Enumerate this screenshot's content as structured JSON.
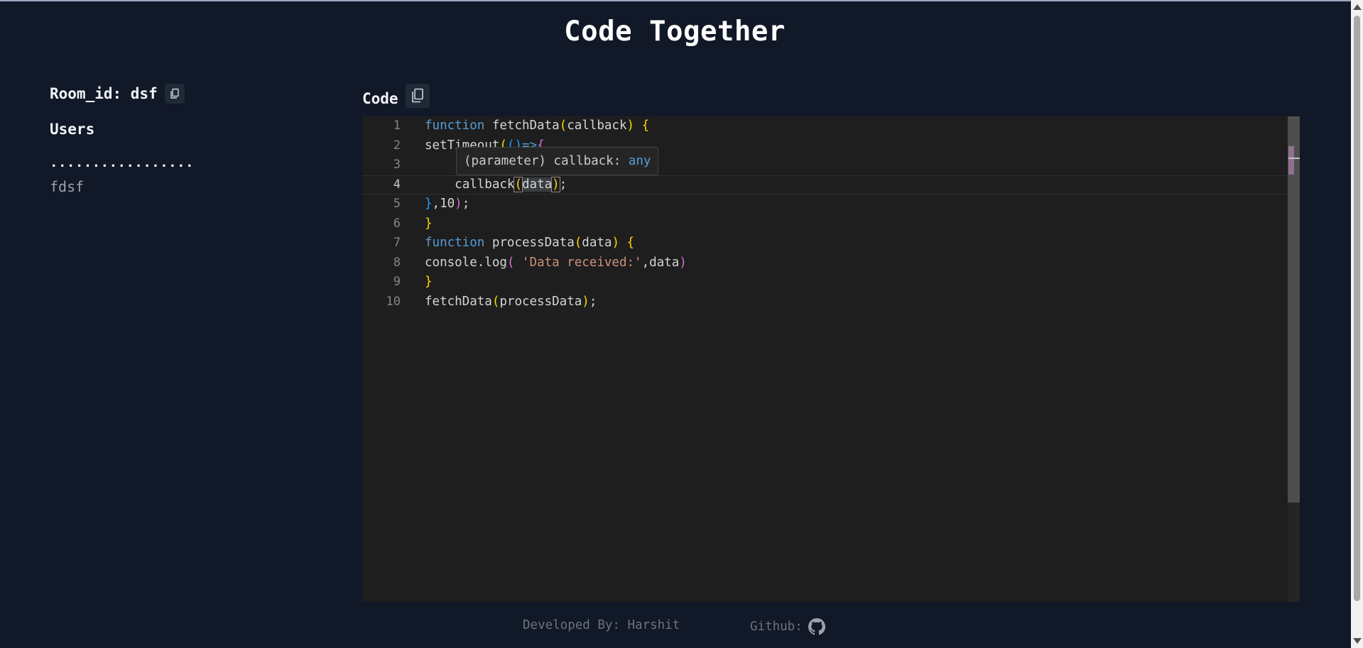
{
  "title": "Code Together",
  "room": {
    "label": "Room_id: dsf"
  },
  "users": {
    "title": "Users",
    "divider": ".................",
    "items": [
      "fdsf"
    ]
  },
  "code": {
    "label": "Code"
  },
  "editor": {
    "line_numbers": [
      "1",
      "2",
      "3",
      "4",
      "5",
      "6",
      "7",
      "8",
      "9",
      "10"
    ],
    "active_line": "4",
    "tooltip": {
      "prefix": "(parameter) callback: ",
      "type": "any"
    },
    "tokens": {
      "l1_kw": "function",
      "l1_fn": "fetchData",
      "l1_po": "(",
      "l1_arg": "callback",
      "l1_pc": ")",
      "l1_brace": " {",
      "l2_fn": "setTimeout",
      "l2_po": "(",
      "l2_args": "()",
      "l2_arrow": "=>",
      "l2_brace": "{",
      "l4_fn": "callback",
      "l4_po": "(",
      "l4_arg": "data",
      "l4_pc": ")",
      "l4_semi": ";",
      "l5_brace": "}",
      "l5_rest": ",10",
      "l5_pc": ")",
      "l5_semi": ";",
      "l6_brace": "}",
      "l7_kw": "function",
      "l7_fn": "processData",
      "l7_po": "(",
      "l7_arg": "data",
      "l7_pc": ")",
      "l7_brace": " {",
      "l8_obj": "console.log",
      "l8_po": "(",
      "l8_str": " 'Data received:'",
      "l8_rest": ",data",
      "l8_pc": ")",
      "l9_brace": "}",
      "l10_fn": "fetchData",
      "l10_po": "(",
      "l10_arg": "processData",
      "l10_pc": ")",
      "l10_semi": ";"
    }
  },
  "footer": {
    "developed_by": "Developed By: Harshit",
    "github_label": "Github:"
  },
  "icons": {
    "copy": "copy-icon",
    "github": "github-icon"
  }
}
